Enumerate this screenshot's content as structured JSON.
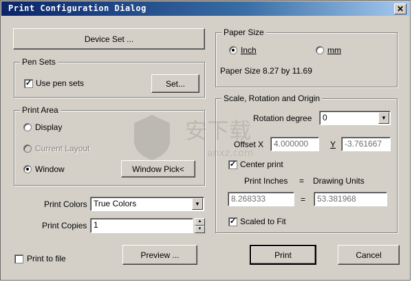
{
  "window": {
    "title": "Print Configuration Dialog",
    "close_glyph": "✕"
  },
  "device": {
    "button_label": "Device Set ..."
  },
  "pen_sets": {
    "group_label": "Pen Sets",
    "use_label": "Use pen sets",
    "use_checked": true,
    "set_button": "Set..."
  },
  "print_area": {
    "group_label": "Print Area",
    "options": [
      "Display",
      "Current Layout",
      "Window"
    ],
    "selected": "Window",
    "window_pick_button": "Window Pick<"
  },
  "print_colors": {
    "label": "Print Colors",
    "value": "True Colors"
  },
  "print_copies": {
    "label": "Print Copies",
    "value": "1"
  },
  "print_to_file": {
    "label": "Print to file",
    "checked": false
  },
  "paper_size": {
    "group_label": "Paper Size",
    "options": [
      "Inch",
      "mm"
    ],
    "selected": "Inch",
    "info": "Paper Size 8.27 by 11.69"
  },
  "scale": {
    "group_label": "Scale, Rotation and Origin",
    "rotation_label": "Rotation degree",
    "rotation_value": "0",
    "offset_x_label": "Offset X",
    "offset_x_value": "4.000000",
    "offset_y_label": "Y",
    "offset_y_value": "-3.761667",
    "center_print_label": "Center print",
    "center_print_checked": true,
    "print_inches_label": "Print Inches",
    "equals": "=",
    "drawing_units_label": "Drawing Units",
    "print_inches_value": "8.268333",
    "drawing_units_value": "53.381968",
    "scaled_to_fit_label": "Scaled to Fit",
    "scaled_to_fit_checked": true
  },
  "footer": {
    "preview": "Preview ...",
    "print": "Print",
    "cancel": "Cancel"
  },
  "watermark": {
    "text": "安下载",
    "subtext": "anxz.com"
  }
}
